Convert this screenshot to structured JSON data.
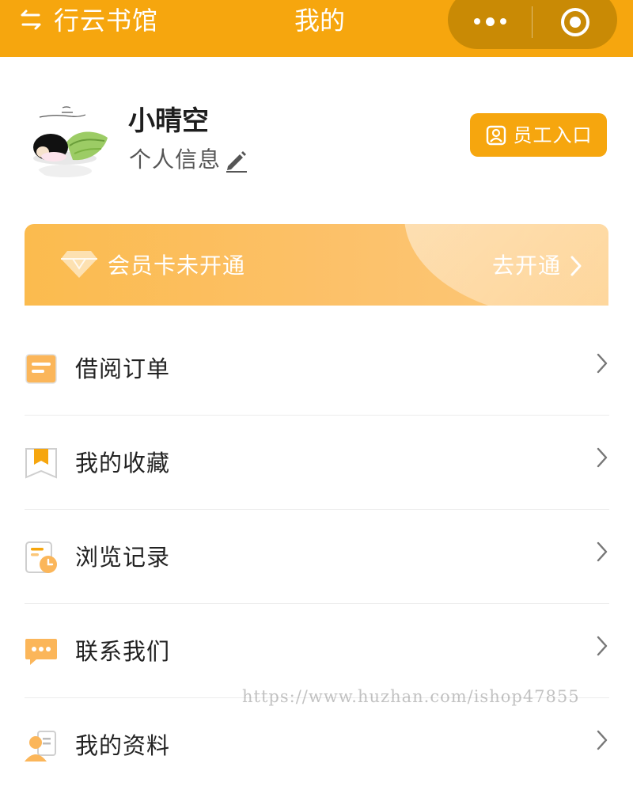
{
  "colors": {
    "brand": "#f6a60e",
    "capsule": "#c98a05",
    "member_gradient_start": "#fbbb4e",
    "member_gradient_end": "#fdc97b",
    "text_primary": "#222222",
    "text_secondary": "#555555",
    "divider": "#ececec"
  },
  "topbar": {
    "app_name": "行云书馆",
    "title": "我的",
    "back_icon": "swap-back-icon",
    "more_icon": "more-dots-icon",
    "close_icon": "target-circle-icon"
  },
  "profile": {
    "avatar_icon": "cartoon-avatar-icon",
    "username": "小晴空",
    "info_label": "个人信息",
    "edit_icon": "pencil-icon",
    "staff_button_label": "员工入口",
    "staff_icon": "id-badge-icon"
  },
  "member": {
    "diamond_icon": "diamond-icon",
    "status": "会员卡未开通",
    "action_label": "去开通"
  },
  "menu": {
    "items": [
      {
        "label": "借阅订单",
        "icon": "order-document-icon"
      },
      {
        "label": "我的收藏",
        "icon": "bookmark-icon"
      },
      {
        "label": "浏览记录",
        "icon": "history-clock-icon"
      },
      {
        "label": "联系我们",
        "icon": "chat-bubble-icon"
      },
      {
        "label": "我的资料",
        "icon": "user-profile-icon"
      }
    ]
  },
  "watermark": "https://www.huzhan.com/ishop47855"
}
